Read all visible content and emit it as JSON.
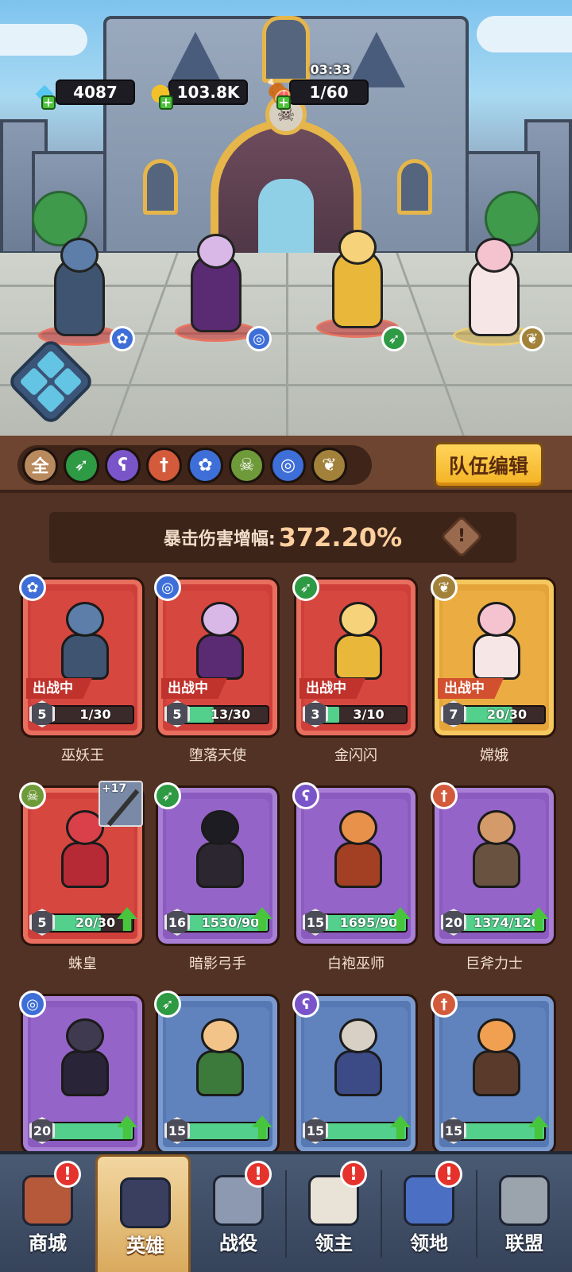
{
  "currency": {
    "gems": "4087",
    "gold": "103.8K",
    "stamina": "1/60",
    "stamina_timer": "03:33"
  },
  "formation": [
    {
      "name": "巫妖王",
      "class_icon": "paw-icon",
      "class_color": "#3e6fd8"
    },
    {
      "name": "堕落天使",
      "class_icon": "swirl-icon",
      "class_color": "#3e6fd8"
    },
    {
      "name": "金闪闪",
      "class_icon": "bow-icon",
      "class_color": "#2e9a44"
    },
    {
      "name": "嫦娥",
      "class_icon": "wings-icon",
      "class_color": "#b08a3a"
    }
  ],
  "filters": [
    {
      "glyph": "全",
      "icon": "all-filter",
      "color": "#b98a5e"
    },
    {
      "glyph": "➶",
      "icon": "bow-icon",
      "color": "#2e9a44"
    },
    {
      "glyph": "ʕ",
      "icon": "staff-icon",
      "color": "#7a55c9"
    },
    {
      "glyph": "†",
      "icon": "sword-icon",
      "color": "#d35a3a"
    },
    {
      "glyph": "✿",
      "icon": "paw-icon",
      "color": "#3e6fd8"
    },
    {
      "glyph": "☠",
      "icon": "skull-icon",
      "color": "#6f9a3a"
    },
    {
      "glyph": "◎",
      "icon": "swirl-icon",
      "color": "#3e6fd8"
    },
    {
      "glyph": "❦",
      "icon": "wings-icon",
      "color": "#a2823a"
    }
  ],
  "team_edit_label": "队伍编辑",
  "stat": {
    "label": "暴击伤害增幅:",
    "value": "372.20%",
    "info_glyph": "!"
  },
  "in_battle_label": "出战中",
  "heroes": [
    {
      "name": "巫妖王",
      "level": "5",
      "shards": "1/30",
      "progress": 0.03,
      "rarity": "red",
      "class_glyph": "✿",
      "class_color": "#3e6fd8",
      "in_battle": true
    },
    {
      "name": "堕落天使",
      "level": "5",
      "shards": "13/30",
      "progress": 0.43,
      "rarity": "red",
      "class_glyph": "◎",
      "class_color": "#3e6fd8",
      "in_battle": true
    },
    {
      "name": "金闪闪",
      "level": "3",
      "shards": "3/10",
      "progress": 0.3,
      "rarity": "red",
      "class_glyph": "➶",
      "class_color": "#2e9a44",
      "in_battle": true
    },
    {
      "name": "嫦娥",
      "level": "7",
      "shards": "20/30",
      "progress": 0.67,
      "rarity": "gold",
      "class_glyph": "❦",
      "class_color": "#a2823a",
      "in_battle": true
    },
    {
      "name": "蛛皇",
      "level": "5",
      "shards": "20/30",
      "progress": 0.67,
      "rarity": "red",
      "class_glyph": "☠",
      "class_color": "#6f9a3a",
      "in_battle": false,
      "upgrade": true,
      "equip": "+17"
    },
    {
      "name": "暗影弓手",
      "level": "16",
      "shards": "1530/90",
      "progress": 1,
      "rarity": "purple",
      "class_glyph": "➶",
      "class_color": "#2e9a44",
      "in_battle": false,
      "upgrade": true
    },
    {
      "name": "白袍巫师",
      "level": "15",
      "shards": "1695/90",
      "progress": 1,
      "rarity": "purple",
      "class_glyph": "ʕ",
      "class_color": "#7a55c9",
      "in_battle": false,
      "upgrade": true
    },
    {
      "name": "巨斧力士",
      "level": "20",
      "shards": "1374/120",
      "progress": 1,
      "rarity": "purple",
      "class_glyph": "†",
      "class_color": "#d35a3a",
      "in_battle": false,
      "upgrade": true
    },
    {
      "name": "",
      "level": "20",
      "shards": "",
      "progress": 1,
      "rarity": "purple",
      "class_glyph": "◎",
      "class_color": "#3e6fd8",
      "in_battle": false,
      "upgrade": true
    },
    {
      "name": "",
      "level": "15",
      "shards": "",
      "progress": 1,
      "rarity": "blue",
      "class_glyph": "➶",
      "class_color": "#2e9a44",
      "in_battle": false,
      "upgrade": true
    },
    {
      "name": "",
      "level": "15",
      "shards": "",
      "progress": 1,
      "rarity": "blue",
      "class_glyph": "ʕ",
      "class_color": "#7a55c9",
      "in_battle": false,
      "upgrade": true
    },
    {
      "name": "",
      "level": "15",
      "shards": "",
      "progress": 1,
      "rarity": "blue",
      "class_glyph": "†",
      "class_color": "#d35a3a",
      "in_battle": false,
      "upgrade": true
    }
  ],
  "nav": [
    {
      "label": "商城",
      "icon": "shop-chest-icon",
      "alert": true,
      "active": false
    },
    {
      "label": "英雄",
      "icon": "hero-cards-icon",
      "alert": false,
      "active": true
    },
    {
      "label": "战役",
      "icon": "crossed-swords-icon",
      "alert": true,
      "active": false
    },
    {
      "label": "领主",
      "icon": "lord-crown-icon",
      "alert": true,
      "active": false
    },
    {
      "label": "领地",
      "icon": "castle-icon",
      "alert": true,
      "active": false
    },
    {
      "label": "联盟",
      "icon": "knight-helmet-icon",
      "alert": false,
      "active": false
    }
  ],
  "alert_glyph": "!",
  "colors": {
    "panel_bg": "#523224",
    "accent_button": "#f4b223",
    "stat_value": "#ffcf9e",
    "progress_fill": "#53d08c"
  }
}
